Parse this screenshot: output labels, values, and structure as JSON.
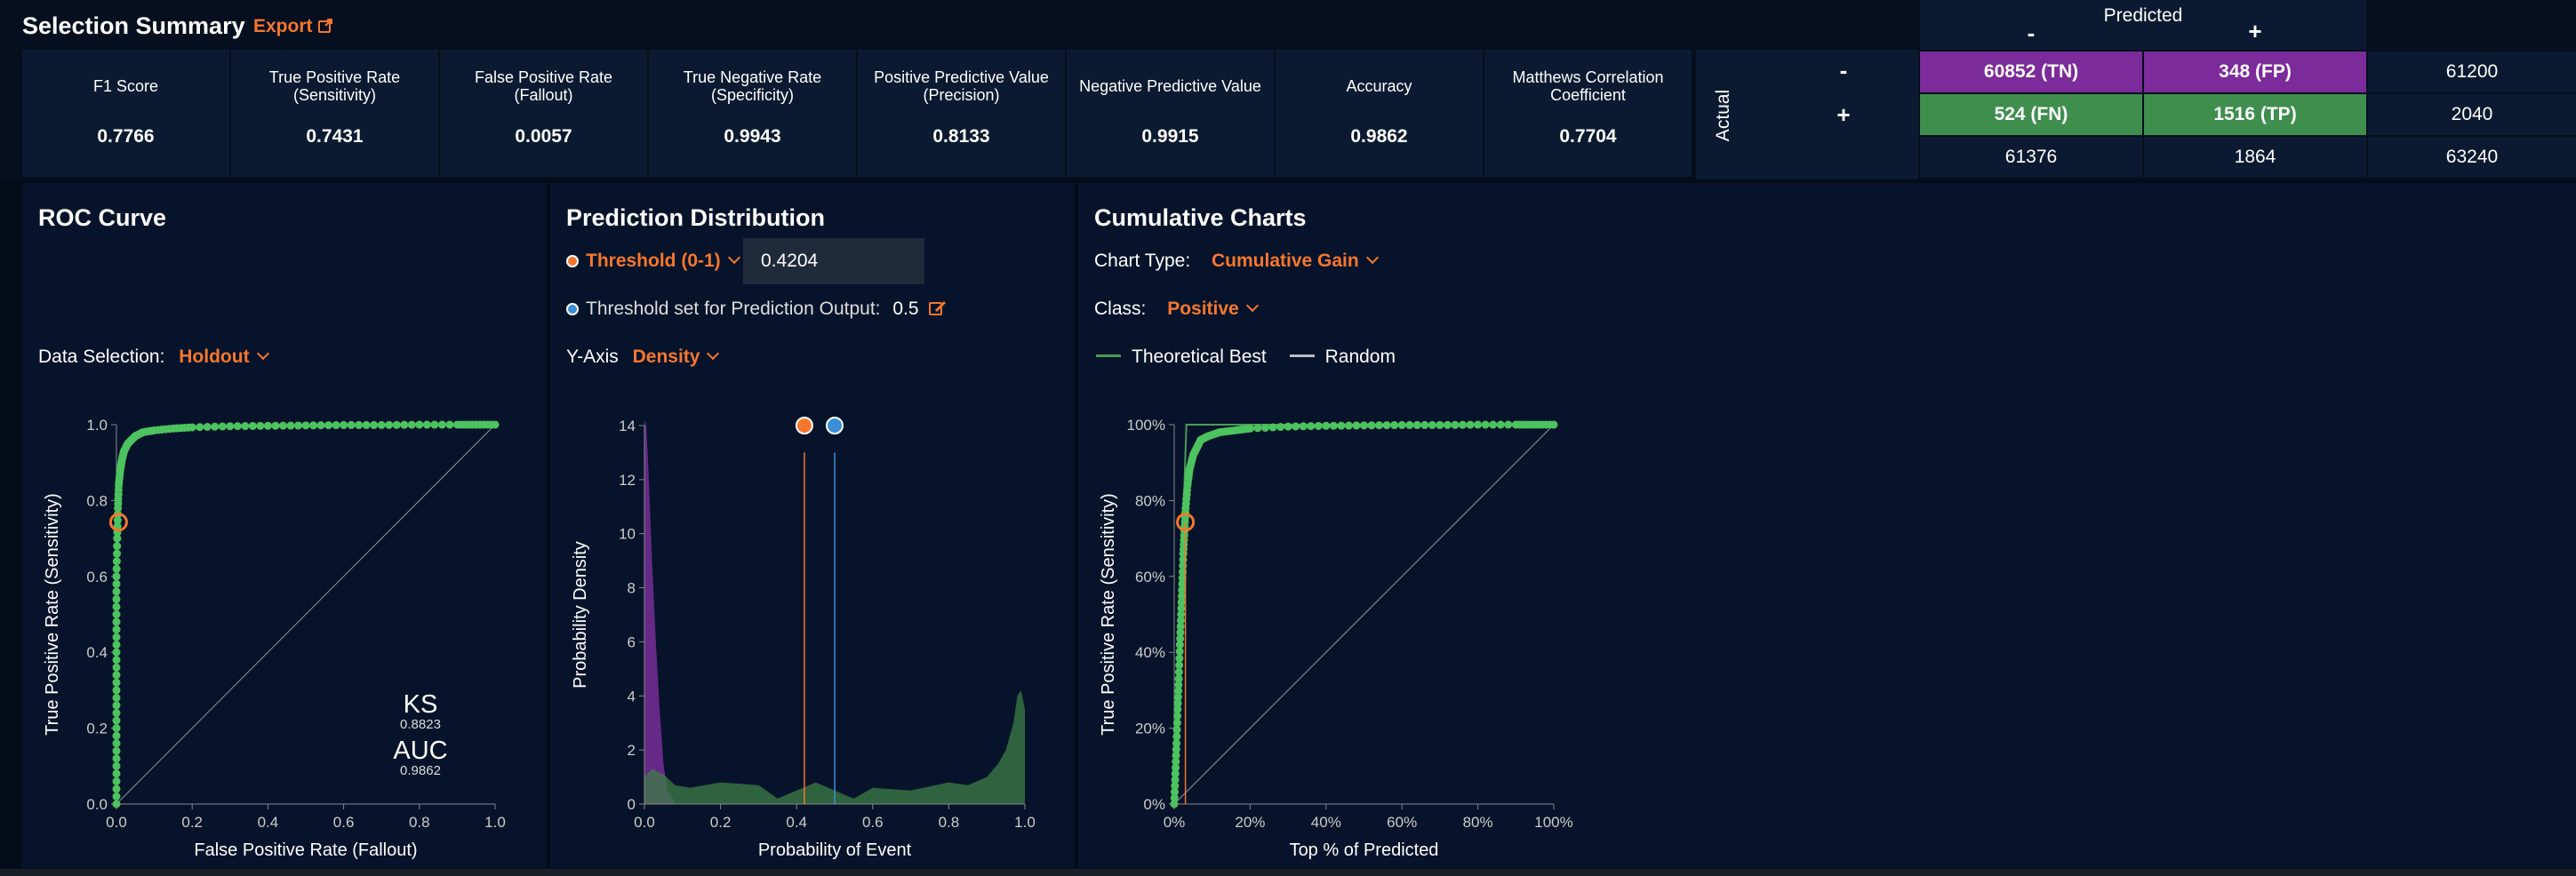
{
  "summary": {
    "title": "Selection Summary",
    "export_label": "Export",
    "metrics": [
      {
        "label": "F1 Score",
        "value": "0.7766"
      },
      {
        "label": "True Positive Rate (Sensitivity)",
        "value": "0.7431"
      },
      {
        "label": "False Positive Rate (Fallout)",
        "value": "0.0057"
      },
      {
        "label": "True Negative Rate (Specificity)",
        "value": "0.9943"
      },
      {
        "label": "Positive Predictive Value (Precision)",
        "value": "0.8133"
      },
      {
        "label": "Negative Predictive Value",
        "value": "0.9915"
      },
      {
        "label": "Accuracy",
        "value": "0.9862"
      },
      {
        "label": "Matthews Correlation Coefficient",
        "value": "0.7704"
      }
    ]
  },
  "confusion": {
    "predicted_label": "Predicted",
    "actual_label": "Actual",
    "minus": "-",
    "plus": "+",
    "tn": "60852 (TN)",
    "fp": "348 (FP)",
    "fn": "524 (FN)",
    "tp": "1516 (TP)",
    "row_neg_total": "61200",
    "row_pos_total": "2040",
    "col_neg_total": "61376",
    "col_pos_total": "1864",
    "grand_total": "63240"
  },
  "roc": {
    "title": "ROC Curve",
    "data_selection_label": "Data Selection:",
    "data_selection_value": "Holdout",
    "ks_label": "KS",
    "ks_value": "0.8823",
    "auc_label": "AUC",
    "auc_value": "0.9862"
  },
  "dist": {
    "title": "Prediction Distribution",
    "threshold_label": "Threshold (0-1)",
    "threshold_value": "0.4204",
    "threshold_output_label": "Threshold set for Prediction Output:",
    "threshold_output_value": "0.5",
    "yaxis_label": "Y-Axis",
    "yaxis_value": "Density"
  },
  "cum": {
    "title": "Cumulative Charts",
    "chart_type_label": "Chart Type:",
    "chart_type_value": "Cumulative Gain",
    "class_label": "Class:",
    "class_value": "Positive",
    "legend_best": "Theoretical Best",
    "legend_random": "Random"
  },
  "colors": {
    "orange": "#f5772e",
    "green_curve": "#4cc35e",
    "purple": "#7c2b9a",
    "green_cell": "#3f8e4e",
    "blue_marker": "#3a8fd6"
  },
  "chart_data": [
    {
      "type": "scatter",
      "title": "ROC Curve",
      "xlabel": "False Positive Rate (Fallout)",
      "ylabel": "True Positive Rate (Sensitivity)",
      "xlim": [
        0,
        1
      ],
      "ylim": [
        0,
        1
      ],
      "xticks": [
        "0.0",
        "0.2",
        "0.4",
        "0.6",
        "0.8",
        "1.0"
      ],
      "yticks": [
        "0.0",
        "0.2",
        "0.4",
        "0.6",
        "0.8",
        "1.0"
      ],
      "series": [
        {
          "x": [
            0,
            0,
            0,
            0,
            0,
            0,
            0,
            0.002,
            0.004,
            0.006,
            0.01,
            0.015,
            0.02,
            0.03,
            0.04,
            0.05,
            0.07,
            0.1,
            0.15,
            0.2,
            0.3,
            0.4,
            0.5,
            0.6,
            0.7,
            0.8,
            0.9,
            0.95,
            1.0
          ],
          "y": [
            0,
            0.1,
            0.2,
            0.3,
            0.4,
            0.5,
            0.6,
            0.7,
            0.78,
            0.84,
            0.88,
            0.91,
            0.93,
            0.95,
            0.96,
            0.97,
            0.98,
            0.985,
            0.99,
            0.993,
            0.996,
            0.997,
            0.998,
            0.999,
            0.999,
            1.0,
            1.0,
            1.0,
            1.0
          ]
        }
      ],
      "highlight": {
        "x": 0.0057,
        "y": 0.7431
      },
      "annotations": [
        {
          "label": "KS",
          "value": "0.8823"
        },
        {
          "label": "AUC",
          "value": "0.9862"
        }
      ]
    },
    {
      "type": "area",
      "title": "Prediction Distribution",
      "xlabel": "Probability of Event",
      "ylabel": "Probability Density",
      "xlim": [
        0,
        1
      ],
      "ylim": [
        0,
        14
      ],
      "xticks": [
        "0.0",
        "0.2",
        "0.4",
        "0.6",
        "0.8",
        "1.0"
      ],
      "yticks": [
        "0",
        "2",
        "4",
        "6",
        "8",
        "10",
        "12",
        "14"
      ],
      "series": [
        {
          "x": [
            0,
            0.005,
            0.01,
            0.02,
            0.03,
            0.04,
            0.05,
            0.06,
            0.08
          ],
          "y": [
            14.2,
            14,
            12.5,
            9,
            6,
            3.5,
            1.5,
            0.5,
            0.1
          ]
        },
        {
          "x": [
            0,
            0.02,
            0.05,
            0.08,
            0.12,
            0.2,
            0.3,
            0.35,
            0.4,
            0.45,
            0.5,
            0.55,
            0.6,
            0.7,
            0.8,
            0.85,
            0.9,
            0.93,
            0.95,
            0.97,
            0.98,
            0.99,
            1.0
          ],
          "y": [
            1.0,
            1.3,
            1.1,
            0.7,
            0.6,
            0.8,
            0.7,
            0.2,
            0.5,
            0.8,
            0.5,
            0.2,
            0.6,
            0.5,
            0.8,
            0.7,
            1.0,
            1.5,
            2.0,
            3.0,
            4.0,
            4.2,
            3.5
          ]
        }
      ],
      "markers": [
        {
          "x": 0.4204
        },
        {
          "x": 0.5
        }
      ]
    },
    {
      "type": "scatter",
      "title": "Cumulative Charts",
      "xlabel": "Top % of Predicted",
      "ylabel": "True Positive Rate (Sensitivity)",
      "xlim": [
        0,
        100
      ],
      "ylim": [
        0,
        100
      ],
      "xticks": [
        "0%",
        "20%",
        "40%",
        "60%",
        "80%",
        "100%"
      ],
      "yticks": [
        "0%",
        "20%",
        "40%",
        "60%",
        "80%",
        "100%"
      ],
      "series": [
        {
          "name": "Theoretical Best",
          "x": [
            0,
            3.2,
            100
          ],
          "y": [
            0,
            100,
            100
          ]
        },
        {
          "name": "Random",
          "x": [
            0,
            100
          ],
          "y": [
            0,
            100
          ]
        },
        {
          "x": [
            0,
            0.3,
            0.6,
            0.9,
            1.2,
            1.5,
            1.8,
            2.1,
            2.4,
            2.7,
            3.0,
            3.5,
            4,
            5,
            6,
            7,
            9,
            12,
            16,
            20,
            30,
            40,
            50,
            60,
            70,
            80,
            90,
            95,
            100
          ],
          "y": [
            0,
            8,
            16,
            25,
            33,
            42,
            50,
            58,
            66,
            72,
            78,
            84,
            88,
            92,
            94,
            96,
            97,
            98,
            98.5,
            99,
            99.5,
            99.7,
            99.8,
            99.9,
            99.9,
            100,
            100,
            100,
            100
          ]
        }
      ],
      "highlight": {
        "x": 2.95,
        "y": 74.31
      }
    }
  ]
}
